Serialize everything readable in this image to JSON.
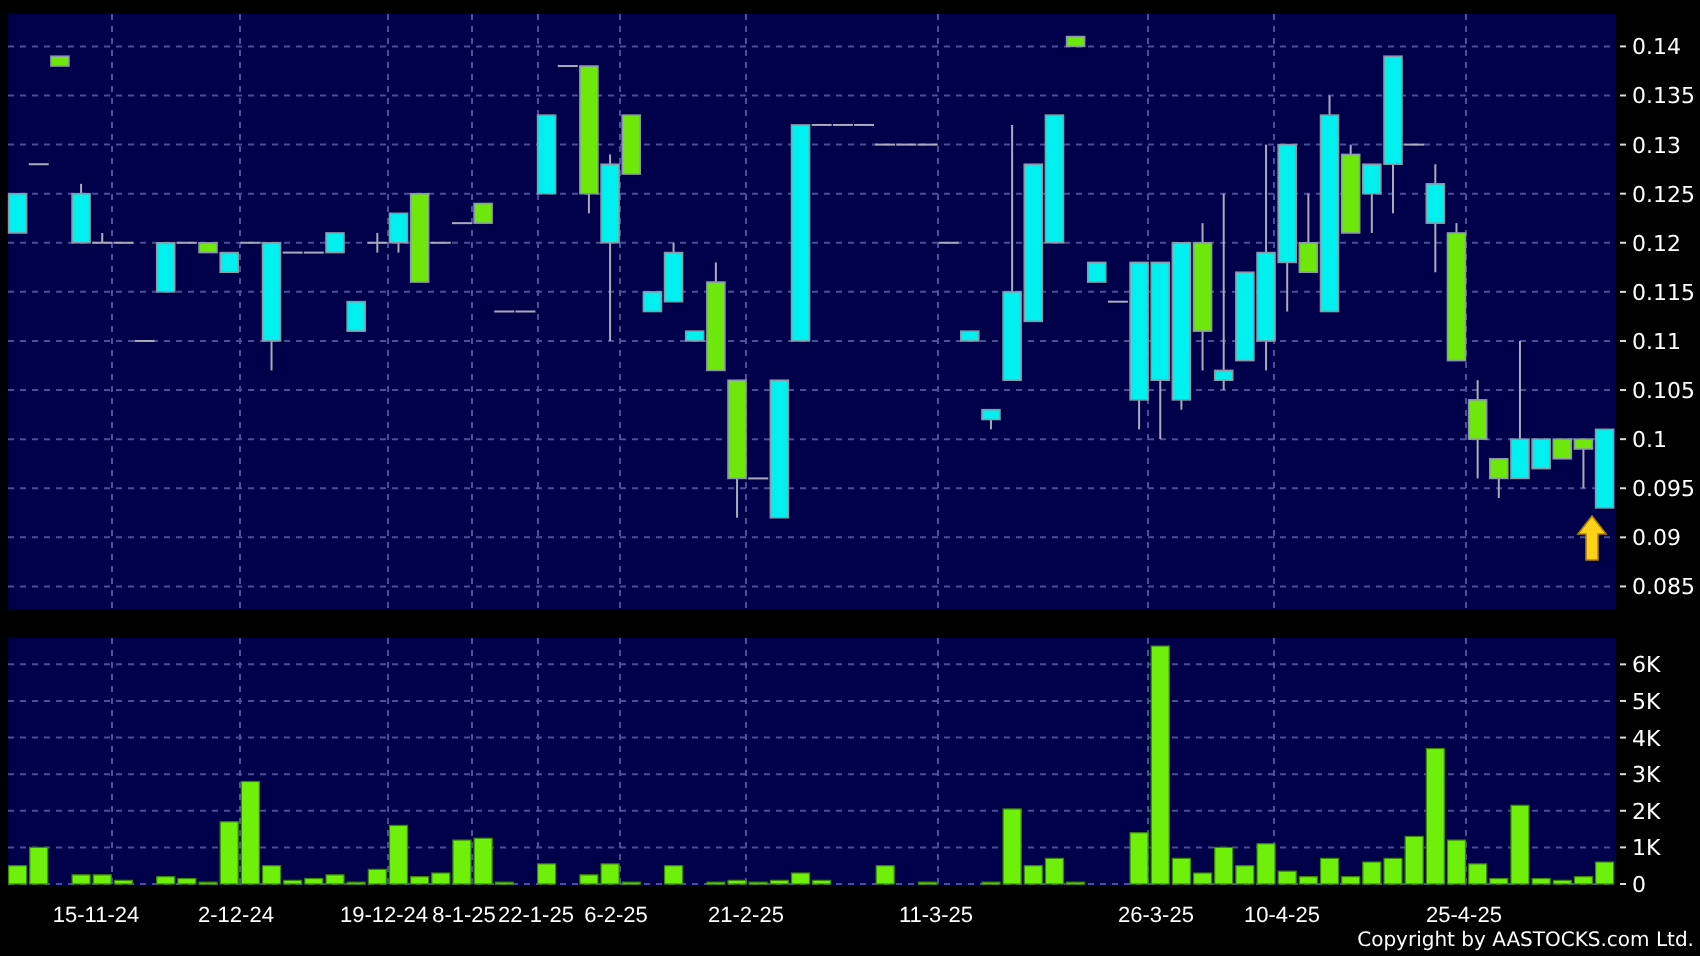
{
  "price_chart": {
    "chart_data": {
      "type": "candlestick",
      "grid": true,
      "ylim": [
        0.0826,
        0.1433
      ],
      "ohlc": [
        [
          0.121,
          0.125,
          0.121,
          0.125
        ],
        [
          0.128,
          0.128,
          0.128,
          0.128
        ],
        [
          0.139,
          0.139,
          0.138,
          0.138
        ],
        [
          0.12,
          0.126,
          0.12,
          0.125
        ],
        [
          0.12,
          0.121,
          0.12,
          0.12
        ],
        [
          0.12,
          0.12,
          0.12,
          0.12
        ],
        [
          0.11,
          0.11,
          0.11,
          0.11
        ],
        [
          0.115,
          0.12,
          0.115,
          0.12
        ],
        [
          0.12,
          0.12,
          0.12,
          0.12
        ],
        [
          0.12,
          0.12,
          0.119,
          0.119
        ],
        [
          0.117,
          0.119,
          0.117,
          0.119
        ],
        [
          0.12,
          0.12,
          0.12,
          0.12
        ],
        [
          0.11,
          0.12,
          0.107,
          0.12
        ],
        [
          0.119,
          0.119,
          0.119,
          0.119
        ],
        [
          0.119,
          0.119,
          0.119,
          0.119
        ],
        [
          0.119,
          0.121,
          0.119,
          0.121
        ],
        [
          0.111,
          0.114,
          0.111,
          0.114
        ],
        [
          0.12,
          0.121,
          0.119,
          0.12
        ],
        [
          0.12,
          0.123,
          0.119,
          0.123
        ],
        [
          0.125,
          0.125,
          0.116,
          0.116
        ],
        [
          0.12,
          0.12,
          0.12,
          0.12
        ],
        [
          0.122,
          0.122,
          0.122,
          0.122
        ],
        [
          0.124,
          0.124,
          0.122,
          0.122
        ],
        [
          0.113,
          0.113,
          0.113,
          0.113
        ],
        [
          0.113,
          0.113,
          0.113,
          0.113
        ],
        [
          0.125,
          0.133,
          0.125,
          0.133
        ],
        [
          0.138,
          0.138,
          0.138,
          0.138
        ],
        [
          0.138,
          0.138,
          0.123,
          0.125
        ],
        [
          0.12,
          0.129,
          0.11,
          0.128
        ],
        [
          0.133,
          0.133,
          0.127,
          0.127
        ],
        [
          0.113,
          0.115,
          0.113,
          0.115
        ],
        [
          0.114,
          0.12,
          0.114,
          0.119
        ],
        [
          0.11,
          0.111,
          0.11,
          0.111
        ],
        [
          0.116,
          0.118,
          0.107,
          0.107
        ],
        [
          0.106,
          0.106,
          0.092,
          0.096
        ],
        [
          0.096,
          0.096,
          0.096,
          0.096
        ],
        [
          0.092,
          0.106,
          0.092,
          0.106
        ],
        [
          0.11,
          0.132,
          0.11,
          0.132
        ],
        [
          0.132,
          0.132,
          0.132,
          0.132
        ],
        [
          0.132,
          0.132,
          0.132,
          0.132
        ],
        [
          0.132,
          0.132,
          0.132,
          0.132
        ],
        [
          0.13,
          0.13,
          0.13,
          0.13
        ],
        [
          0.13,
          0.13,
          0.13,
          0.13
        ],
        [
          0.13,
          0.13,
          0.13,
          0.13
        ],
        [
          0.12,
          0.12,
          0.12,
          0.12
        ],
        [
          0.11,
          0.111,
          0.11,
          0.111
        ],
        [
          0.102,
          0.103,
          0.101,
          0.103
        ],
        [
          0.106,
          0.132,
          0.106,
          0.115
        ],
        [
          0.112,
          0.128,
          0.112,
          0.128
        ],
        [
          0.12,
          0.133,
          0.12,
          0.133
        ],
        [
          0.141,
          0.141,
          0.14,
          0.14
        ],
        [
          0.116,
          0.118,
          0.116,
          0.118
        ],
        [
          0.114,
          0.114,
          0.114,
          0.114
        ],
        [
          0.104,
          0.118,
          0.101,
          0.118
        ],
        [
          0.106,
          0.118,
          0.1,
          0.118
        ],
        [
          0.104,
          0.12,
          0.103,
          0.12
        ],
        [
          0.12,
          0.122,
          0.107,
          0.111
        ],
        [
          0.106,
          0.125,
          0.105,
          0.107
        ],
        [
          0.108,
          0.117,
          0.108,
          0.117
        ],
        [
          0.11,
          0.13,
          0.107,
          0.119
        ],
        [
          0.118,
          0.13,
          0.113,
          0.13
        ],
        [
          0.12,
          0.125,
          0.117,
          0.117
        ],
        [
          0.113,
          0.135,
          0.113,
          0.133
        ],
        [
          0.129,
          0.13,
          0.121,
          0.121
        ],
        [
          0.125,
          0.128,
          0.121,
          0.128
        ],
        [
          0.128,
          0.139,
          0.123,
          0.139
        ],
        [
          0.13,
          0.13,
          0.13,
          0.13
        ],
        [
          0.122,
          0.128,
          0.117,
          0.126
        ],
        [
          0.121,
          0.122,
          0.108,
          0.108
        ],
        [
          0.104,
          0.106,
          0.096,
          0.1
        ],
        [
          0.098,
          0.098,
          0.094,
          0.096
        ],
        [
          0.096,
          0.11,
          0.096,
          0.1
        ],
        [
          0.097,
          0.1,
          0.097,
          0.1
        ],
        [
          0.1,
          0.1,
          0.098,
          0.098
        ],
        [
          0.1,
          0.1,
          0.095,
          0.099
        ],
        [
          0.093,
          0.101,
          0.093,
          0.101
        ]
      ],
      "yticks": [
        {
          "value": 0.14,
          "label": "0.14"
        },
        {
          "value": 0.135,
          "label": "0.135"
        },
        {
          "value": 0.13,
          "label": "0.13"
        },
        {
          "value": 0.125,
          "label": "0.125"
        },
        {
          "value": 0.12,
          "label": "0.12"
        },
        {
          "value": 0.115,
          "label": "0.115"
        },
        {
          "value": 0.11,
          "label": "0.11"
        },
        {
          "value": 0.105,
          "label": "0.105"
        },
        {
          "value": 0.1,
          "label": "0.1"
        },
        {
          "value": 0.095,
          "label": "0.095"
        },
        {
          "value": 0.09,
          "label": "0.09"
        },
        {
          "value": 0.085,
          "label": "0.085"
        }
      ]
    }
  },
  "volume_chart": {
    "chart_data": {
      "type": "bar",
      "grid": true,
      "ylim": [
        0,
        6720
      ],
      "values": [
        500,
        1000,
        null,
        250,
        250,
        100,
        null,
        200,
        150,
        50,
        1700,
        2800,
        500,
        100,
        150,
        250,
        50,
        400,
        1600,
        200,
        300,
        1200,
        1250,
        50,
        null,
        550,
        null,
        250,
        550,
        50,
        null,
        500,
        null,
        50,
        100,
        50,
        100,
        300,
        100,
        null,
        null,
        500,
        null,
        50,
        null,
        null,
        50,
        2050,
        500,
        700,
        50,
        null,
        null,
        1400,
        6500,
        700,
        300,
        1000,
        500,
        1100,
        350,
        200,
        700,
        200,
        600,
        700,
        1300,
        3700,
        1200,
        550,
        150,
        2150,
        150,
        100,
        200,
        600
      ],
      "yticks": [
        {
          "value": 0,
          "label": "0"
        },
        {
          "value": 1000,
          "label": "1K"
        },
        {
          "value": 2000,
          "label": "2K"
        },
        {
          "value": 3000,
          "label": "3K"
        },
        {
          "value": 4000,
          "label": "4K"
        },
        {
          "value": 5000,
          "label": "5K"
        },
        {
          "value": 6000,
          "label": "6K"
        }
      ]
    },
    "date_labels": [
      "15-11-24",
      "2-12-24",
      "19-12-24",
      "8-1-25",
      "22-1-25",
      "6-2-25",
      "21-2-25",
      "11-3-25",
      "26-3-25",
      "10-4-25",
      "25-4-25"
    ]
  },
  "footer": {
    "copyright": "Copyright by AASTOCKS.com Ltd."
  }
}
